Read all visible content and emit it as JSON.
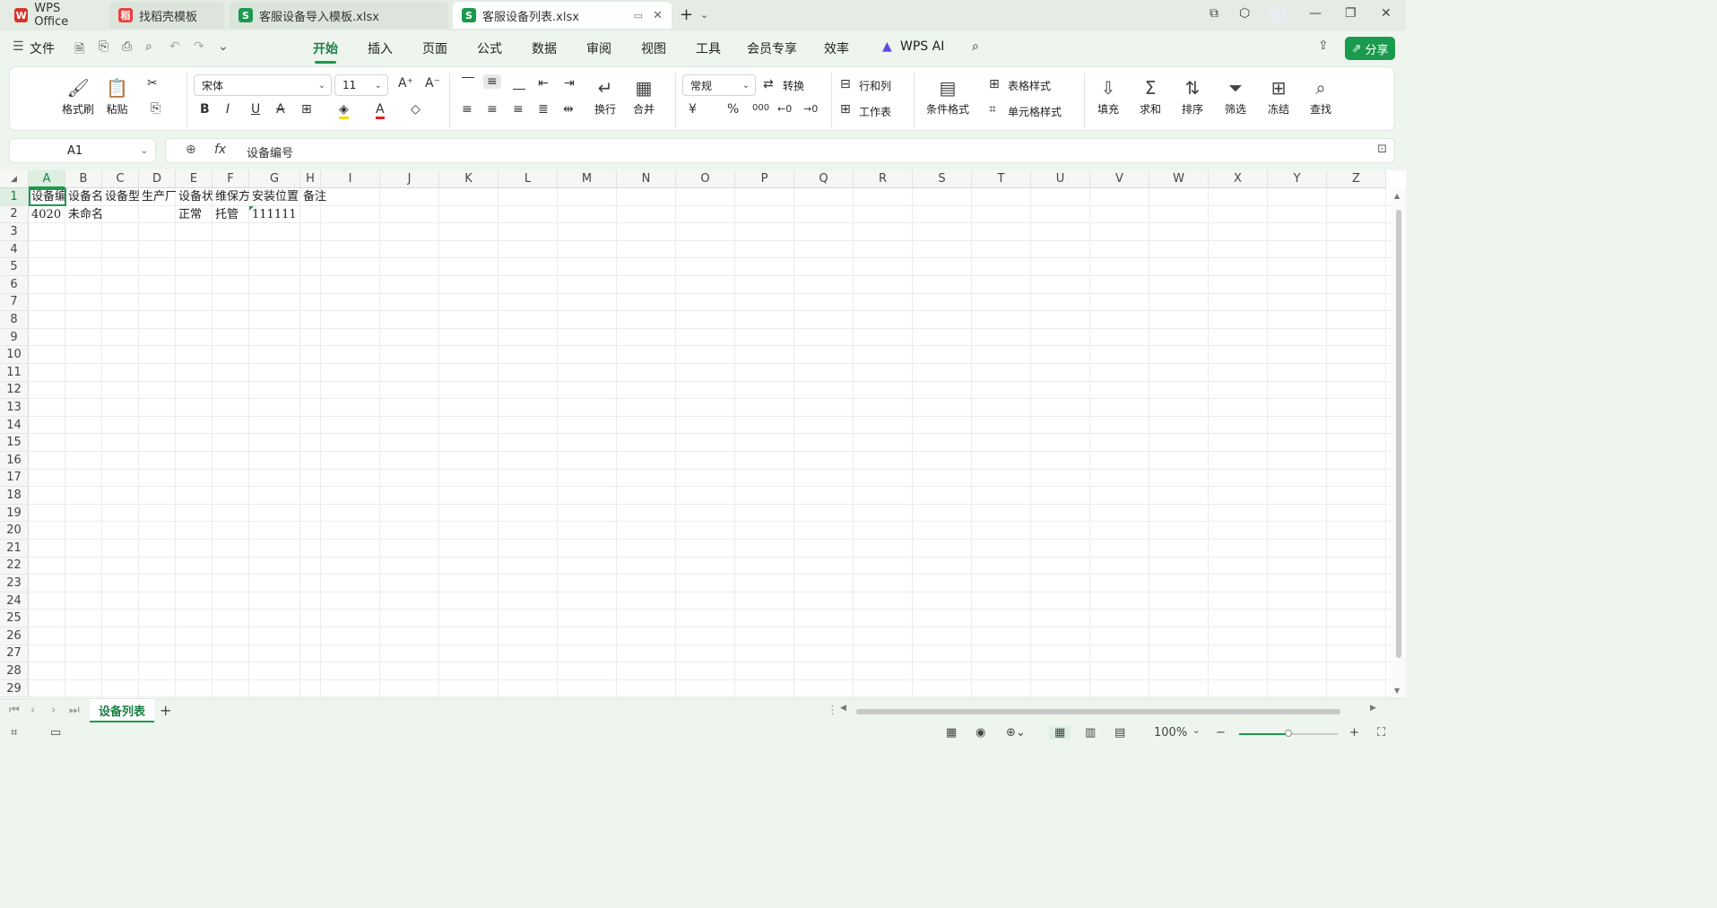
{
  "titlebar": {
    "tabs": [
      {
        "label": "WPS Office",
        "icon": "wps-logo-icon",
        "color": "#d9342b",
        "glyph": "W"
      },
      {
        "label": "找稻壳模板",
        "icon": "docer-icon",
        "color": "#e8413b",
        "glyph": "稻"
      },
      {
        "label": "客服设备导入模板.xlsx",
        "icon": "spreadsheet-icon",
        "color": "#1a9a4d",
        "glyph": "S"
      },
      {
        "label": "客服设备列表.xlsx",
        "icon": "spreadsheet-icon",
        "color": "#1a9a4d",
        "glyph": "S"
      }
    ],
    "new_tab": "+"
  },
  "menubar": {
    "file_label": "文件",
    "tabs": [
      "开始",
      "插入",
      "页面",
      "公式",
      "数据",
      "审阅",
      "视图",
      "工具",
      "会员专享",
      "效率"
    ],
    "active_tab": "开始",
    "ai_label": "WPS AI",
    "share_label": "分享"
  },
  "ribbon": {
    "format_painter": "格式刷",
    "paste": "粘贴",
    "font_name": "宋体",
    "font_size": "11",
    "wrap": "换行",
    "merge": "合并",
    "number_format": "常规",
    "convert": "转换",
    "rows_cols": "行和列",
    "worksheet": "工作表",
    "conditional_format": "条件格式",
    "table_style": "表格样式",
    "cell_style": "单元格样式",
    "fill": "填充",
    "sum": "求和",
    "sort": "排序",
    "filter": "筛选",
    "freeze": "冻结",
    "find": "查找",
    "currency": "¥",
    "percent": "%",
    "thousands": "000"
  },
  "formula_bar": {
    "name_box": "A1",
    "fx": "fx",
    "content": "设备编号"
  },
  "sheet": {
    "columns": [
      "A",
      "B",
      "C",
      "D",
      "E",
      "F",
      "G",
      "H",
      "I",
      "J",
      "K",
      "L",
      "M",
      "N",
      "O",
      "P",
      "Q",
      "R",
      "S",
      "T",
      "U",
      "V",
      "W",
      "X",
      "Y",
      "Z"
    ],
    "rows": [
      "1",
      "2",
      "3",
      "4",
      "5",
      "6",
      "7",
      "8",
      "9",
      "10",
      "11",
      "12",
      "13",
      "14",
      "15",
      "16",
      "17",
      "18",
      "19",
      "20",
      "21",
      "22",
      "23",
      "24",
      "25",
      "26",
      "27",
      "28",
      "29"
    ],
    "header_row": [
      "设备编号",
      "设备名称",
      "设备型号",
      "生产厂家",
      "设备状态",
      "维保方式",
      "安装位置",
      "备注"
    ],
    "data_row": [
      "4020",
      "未命名",
      "",
      "",
      "正常",
      "托管",
      "111111",
      ""
    ],
    "selected_cell": "A1"
  },
  "sheet_tabs": {
    "active": "设备列表",
    "add": "+"
  },
  "status": {
    "zoom": "100%",
    "zoom_level": 0.5
  },
  "colors": {
    "accent": "#1a9a4d",
    "active_tab_text": "#1a7f44"
  }
}
